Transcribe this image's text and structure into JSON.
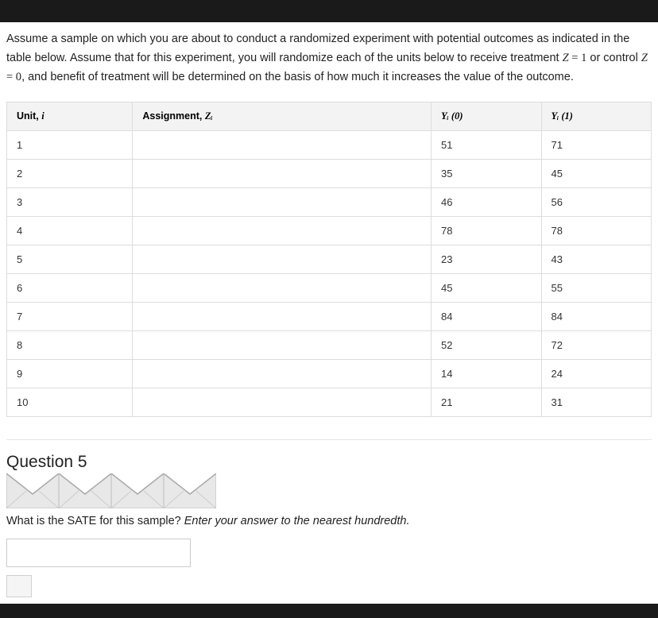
{
  "description_parts": {
    "p1": "Assume a sample on which you are about to conduct a randomized experiment with potential outcomes as indicated in the table below.  Assume that for this experiment, you will randomize each of the units below to receive treatment ",
    "z1": "Z",
    "eq1": " = 1",
    "p2": " or control ",
    "z2": "Z",
    "eq2": " = 0",
    "p3": ", and benefit of treatment will be determined on the basis of how much it increases the value of the outcome."
  },
  "table": {
    "headers": {
      "unit": "Unit, ",
      "unit_i": "i",
      "assignment": "Assignment, ",
      "assignment_zi": "Zᵢ",
      "y0": "Yᵢ (0)",
      "y1": "Yᵢ (1)"
    },
    "rows": [
      {
        "unit": "1",
        "assignment": "",
        "y0": "51",
        "y1": "71"
      },
      {
        "unit": "2",
        "assignment": "",
        "y0": "35",
        "y1": "45"
      },
      {
        "unit": "3",
        "assignment": "",
        "y0": "46",
        "y1": "56"
      },
      {
        "unit": "4",
        "assignment": "",
        "y0": "78",
        "y1": "78"
      },
      {
        "unit": "5",
        "assignment": "",
        "y0": "23",
        "y1": "43"
      },
      {
        "unit": "6",
        "assignment": "",
        "y0": "45",
        "y1": "55"
      },
      {
        "unit": "7",
        "assignment": "",
        "y0": "84",
        "y1": "84"
      },
      {
        "unit": "8",
        "assignment": "",
        "y0": "52",
        "y1": "72"
      },
      {
        "unit": "9",
        "assignment": "",
        "y0": "14",
        "y1": "24"
      },
      {
        "unit": "10",
        "assignment": "",
        "y0": "21",
        "y1": "31"
      }
    ]
  },
  "question": {
    "title": "Question 5",
    "prompt_text": "What is the SATE for this sample? ",
    "prompt_hint": "Enter your answer to the nearest hundredth.",
    "input_value": ""
  }
}
